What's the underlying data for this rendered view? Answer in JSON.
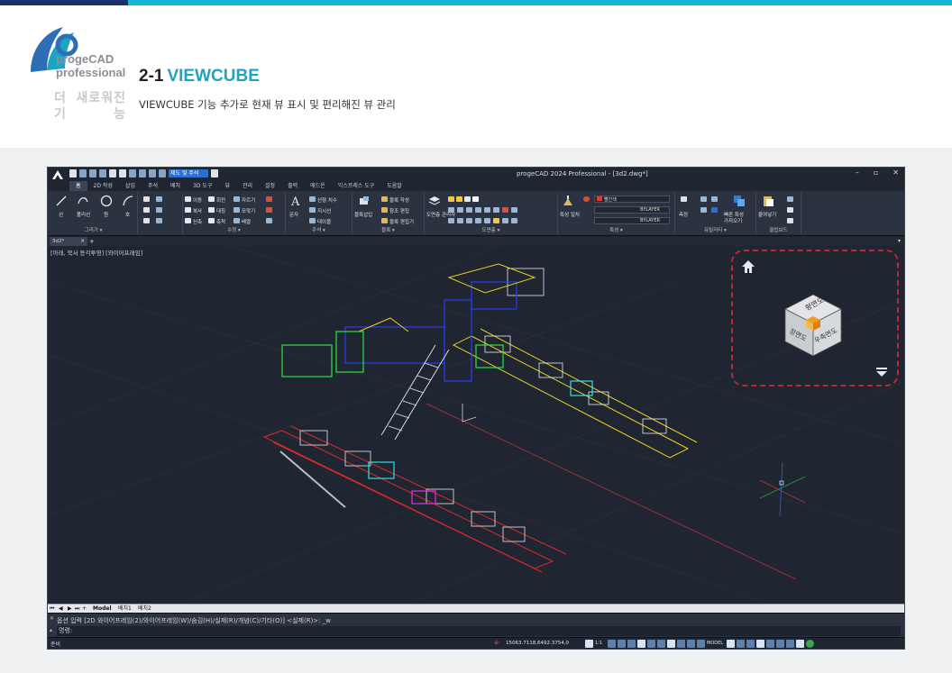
{
  "header": {
    "logo_line1": "progeCAD",
    "logo_line2": "professional",
    "side_label_row1": [
      "더",
      "새로워진"
    ],
    "side_label_row2": [
      "기",
      "능"
    ],
    "section_number": "2-1",
    "section_title": "VIEWCUBE",
    "description": "VIEWCUBE 기능 추가로 현재 뷰 표시 및 편리해진 뷰 관리"
  },
  "app": {
    "window_title": "progeCAD 2024 Professional - [3d2.dwg*]",
    "search_label": "제도 및 주석",
    "window_buttons": [
      "–",
      "▫",
      "✕"
    ],
    "menu_tabs": [
      "홈",
      "2D 작성",
      "삽입",
      "주석",
      "배치",
      "3D 도구",
      "뷰",
      "관리",
      "설정",
      "출력",
      "애드온",
      "익스프레스 도구",
      "도움말"
    ],
    "active_tab": "홈",
    "ribbon": {
      "draw": {
        "title": "그리기 ▾",
        "line": "선",
        "polyline": "폴리선",
        "circle": "원",
        "arc": "호"
      },
      "modify": {
        "title": "수정 ▾",
        "move": "이동",
        "rotate": "회전",
        "trim": "자르기",
        "copy": "복사",
        "mirror": "대칭",
        "fillet": "모깎기",
        "stretch": "신축",
        "scale": "축척",
        "array": "배열"
      },
      "annotation": {
        "title": "주석 ▾",
        "text": "문자",
        "dim_linear": "선형 치수",
        "leader": "지시선",
        "table": "테이블"
      },
      "block": {
        "title": "블록 ▾",
        "insert": "블록삽입",
        "create": "블록 작성",
        "ref_edit": "참조 편집",
        "block_edit": "블록 편집기"
      },
      "layer": {
        "title": "도면층 ▾",
        "manager": "도면층 관리자"
      },
      "properties": {
        "title": "특성 ▾",
        "match": "특성 일치",
        "color": "빨간색",
        "linetype": "BYLAYER",
        "lineweight": "BYLAYER"
      },
      "utilities": {
        "title": "유틸리티 ▾",
        "measure": "측정",
        "quick": "빠른 특성",
        "select": "가져오기"
      },
      "clipboard": {
        "title": "클립보드",
        "paste": "붙여넣기"
      }
    },
    "doc_tab": "3d2*",
    "viewport_label": "[아래, 북서 등각투영] [와이어프레임]",
    "viewcube_faces": {
      "top": "평면도",
      "front": "정면도",
      "right": "우측면도"
    },
    "layout_tabs": [
      "Model",
      "배치1",
      "배치2"
    ],
    "command_history": "옵션 입력 [2D 와이어프레임(2)/와이어프레임(W)/숨김(H)/실제(R)/개념(C)/기타(O)] <실제(R)>: _w",
    "command_prompt": "명령:",
    "status_left": "준비",
    "coordinates": "15063.7118,6492.3754,0",
    "scale": "1:1",
    "model_label": "MODEL"
  },
  "colors": {
    "accent": "#1fa3c4",
    "brand_dark": "#1a2f6e",
    "highlight_dashed": "#b72a3d",
    "viewport_bg": "#1f2631"
  }
}
